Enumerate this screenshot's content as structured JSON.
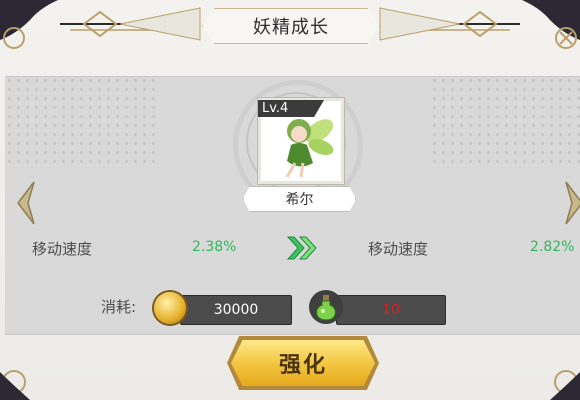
{
  "header": {
    "title": "妖精成长"
  },
  "fairy": {
    "level_label": "Lv.4",
    "name": "希尔"
  },
  "stats": {
    "current": {
      "label": "移动速度",
      "value": "2.38%"
    },
    "next": {
      "label": "移动速度",
      "value": "2.82%"
    }
  },
  "cost": {
    "label": "消耗:",
    "gold": "30000",
    "item": "10",
    "item_color": "#d52222"
  },
  "actions": {
    "enhance_label": "强化"
  },
  "colors": {
    "accent_gold": "#f2c43d",
    "stat_green": "#2fb85a",
    "frame_gold": "#b9a06a"
  },
  "icons": [
    "left-arrow-icon",
    "right-arrow-icon",
    "upgrade-arrow-icon",
    "gold-coin-icon",
    "potion-icon",
    "close-icon"
  ]
}
